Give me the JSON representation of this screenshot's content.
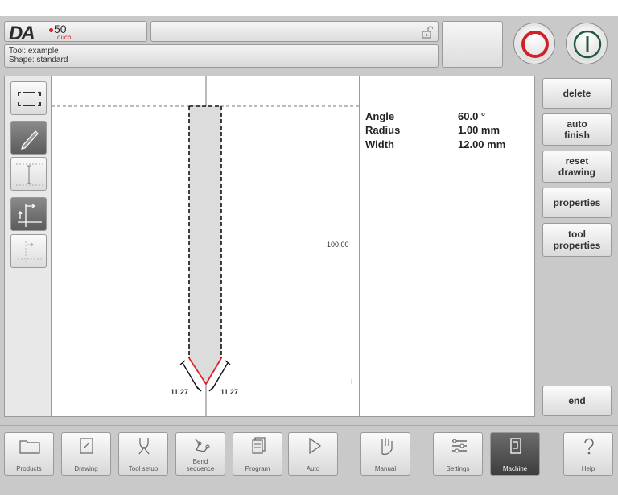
{
  "header": {
    "logo_da": "DA",
    "logo_num": "50",
    "logo_touch": "Touch",
    "tool_line": "Tool: example",
    "shape_line": "Shape: standard",
    "lock_icon": "lock-open-icon",
    "stop_icon": "stop-icon",
    "start_icon": "start-icon"
  },
  "toolbar": {
    "icons": [
      "select-frame-icon",
      "pencil-icon",
      "vertical-dimension-icon",
      "axis-move-icon",
      "offset-axis-icon"
    ]
  },
  "drawing": {
    "height_label": "100.00",
    "left_width_label": "11.27",
    "right_width_label": "11.27"
  },
  "properties": {
    "rows": [
      {
        "name": "Angle",
        "value": "60.0 °"
      },
      {
        "name": "Radius",
        "value": "1.00 mm"
      },
      {
        "name": "Width",
        "value": "12.00 mm"
      }
    ]
  },
  "side_buttons": {
    "delete": "delete",
    "auto_finish_1": "auto",
    "auto_finish_2": "finish",
    "reset_drawing_1": "reset",
    "reset_drawing_2": "drawing",
    "properties": "properties",
    "tool_properties_1": "tool",
    "tool_properties_2": "properties",
    "end": "end"
  },
  "nav": {
    "products": "Products",
    "drawing": "Drawing",
    "tool_setup": "Tool setup",
    "bend_1": "Bend",
    "bend_2": "sequence",
    "program": "Program",
    "auto": "Auto",
    "manual": "Manual",
    "settings": "Settings",
    "machine": "Machine",
    "help": "Help"
  },
  "colors": {
    "stop_red": "#d0202a",
    "start_green": "#1f5a3a",
    "background_gray": "#c9c9c9"
  }
}
